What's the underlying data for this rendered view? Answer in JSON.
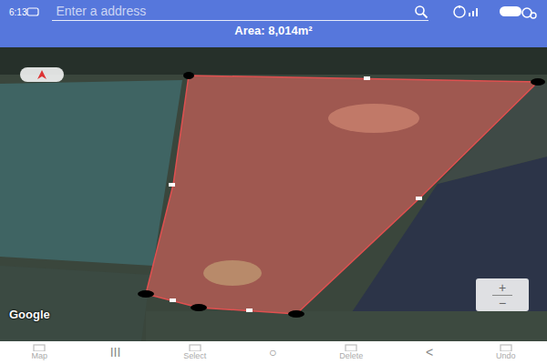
{
  "status_bar": {
    "time": "6:13"
  },
  "search": {
    "placeholder": "Enter a address"
  },
  "area": {
    "text": "Area: 8,014m²"
  },
  "map": {
    "attribution": "Google",
    "zoom": {
      "plus": "+",
      "minus": "−"
    }
  },
  "bottom_bar": [
    {
      "kind": "tool",
      "label": "Map"
    },
    {
      "kind": "nav",
      "label": "III"
    },
    {
      "kind": "tool",
      "label": "Select"
    },
    {
      "kind": "nav",
      "label": "○"
    },
    {
      "kind": "tool",
      "label": "Delete"
    },
    {
      "kind": "nav",
      "label": "<"
    },
    {
      "kind": "tool",
      "label": "Undo"
    }
  ]
}
